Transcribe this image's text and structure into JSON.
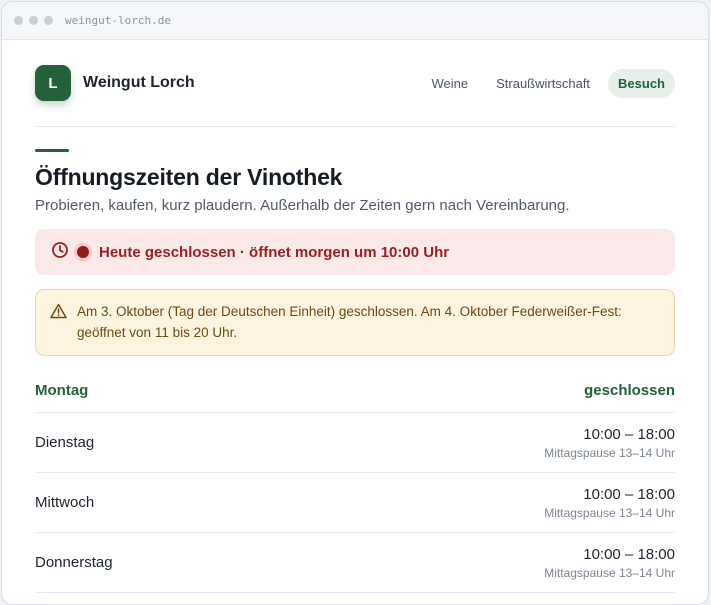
{
  "browser": {
    "url": "weingut-lorch.de"
  },
  "header": {
    "logo_letter": "L",
    "brand": "Weingut Lorch",
    "nav": [
      {
        "label": "Weine",
        "active": false
      },
      {
        "label": "Straußwirtschaft",
        "active": false
      },
      {
        "label": "Besuch",
        "active": true
      }
    ]
  },
  "main": {
    "title": "Öffnungszeiten der Vinothek",
    "subtitle": "Probieren, kaufen, kurz plaudern. Außerhalb der Zeiten gern nach Vereinbarung.",
    "status": {
      "icon": "clock-icon",
      "text": "Heute geschlossen · öffnet morgen um 10:00 Uhr"
    },
    "notice": {
      "icon": "warning-icon",
      "text": "Am 3. Oktober (Tag der Deutschen Einheit) geschlossen. Am 4. Oktober Federweißer-Fest: geöffnet von 11 bis 20 Uhr."
    },
    "hours": [
      {
        "day": "Montag",
        "closed_label": "geschlossen"
      },
      {
        "day": "Dienstag",
        "time": "10:00 – 18:00",
        "note": "Mittagspause 13–14 Uhr"
      },
      {
        "day": "Mittwoch",
        "time": "10:00 – 18:00",
        "note": "Mittagspause 13–14 Uhr"
      },
      {
        "day": "Donnerstag",
        "time": "10:00 – 18:00",
        "note": "Mittagspause 13–14 Uhr"
      }
    ]
  },
  "colors": {
    "brand_green": "#24603a",
    "closed_red": "#9a1f1f",
    "notice_amber": "#6b4a12"
  }
}
